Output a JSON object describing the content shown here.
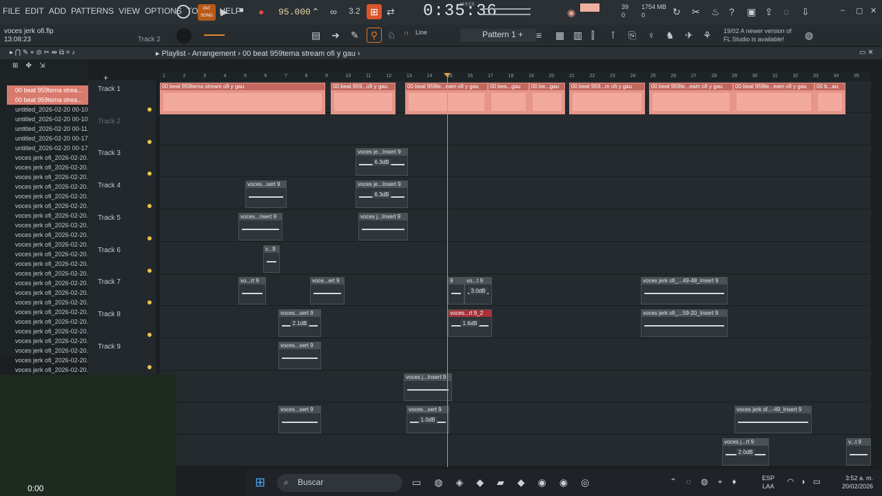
{
  "menu": [
    "FILE",
    "EDIT",
    "ADD",
    "PATTERNS",
    "VIEW",
    "OPTIONS",
    "TOOLS",
    "HELP"
  ],
  "transport": {
    "mode_pat": "PAT",
    "mode_song": "SONG",
    "tempo": "95.000",
    "clock": "0:35:36",
    "clock_unit": "M:S:CS",
    "cpu": "39",
    "cpu2": "0",
    "memory": "1754 MB",
    "memory2": "0"
  },
  "file": {
    "name": "voces jerk ofi.flp",
    "time": "13:08:23",
    "hint": "Track 2"
  },
  "toolbar": {
    "line_label": "Line",
    "pattern_label": "Pattern 1"
  },
  "notice": {
    "date": "19/02",
    "line1": "A newer version of",
    "line2": "FL Studio is available!"
  },
  "playlist": {
    "title": "Playlist - Arrangement",
    "breadcrumb": "00 beat 959tema stream ofi y gau"
  },
  "browser": {
    "items": [
      "00 beat 959tema strea...",
      "00 beat 959tema strea...",
      "untitled_2026-02-20 00-10...",
      "untitled_2026-02-20 00-10...",
      "untitled_2026-02-20 00-11...",
      "untitled_2026-02-20 00-17...",
      "untitled_2026-02-20 00-17...",
      "voces jerk ofi_2026-02-20...",
      "voces jerk ofi_2026-02-20...",
      "voces jerk ofi_2026-02-20...",
      "voces jerk ofi_2026-02-20...",
      "voces jerk ofi_2026-02-20...",
      "voces jerk ofi_2026-02-20...",
      "voces jerk ofi_2026-02-20...",
      "voces jerk ofi_2026-02-20...",
      "voces jerk ofi_2026-02-20...",
      "voces jerk ofi_2026-02-20...",
      "voces jerk ofi_2026-02-20...",
      "voces jerk ofi_2026-02-20...",
      "voces jerk ofi_2026-02-20...",
      "voces jerk ofi_2026-02-20...",
      "voces jerk ofi_2026-02-20...",
      "voces jerk ofi_2026-02-20...",
      "voces jerk ofi_2026-02-20...",
      "voces jerk ofi_2026-02-20...",
      "voces jerk ofi_2026-02-20...",
      "voces jerk ofi_2026-02-20...",
      "voces jerk ofi_2026-02-20...",
      "voces jerk ofi_2026-02-20...",
      "voces jerk ofi_2026-02-20..."
    ]
  },
  "tracks": [
    "Track 1",
    "Track 2",
    "Track 3",
    "Track 4",
    "Track 5",
    "Track 6",
    "Track 7",
    "Track 8",
    "Track 9"
  ],
  "ruler": [
    "1",
    "2",
    "3",
    "4",
    "5",
    "6",
    "7",
    "8",
    "9",
    "10",
    "11",
    "12",
    "13",
    "14",
    "15",
    "16",
    "17",
    "18",
    "19",
    "20",
    "21",
    "22",
    "23",
    "24",
    "25",
    "26",
    "27",
    "28",
    "29",
    "30",
    "31",
    "32",
    "33",
    "34",
    "35"
  ],
  "clips": {
    "t1a": "00 beat 959tema stream ofi y gau",
    "t1b": "00 beat 959...ofi y gau",
    "t1c": "00 beat 959te...eam ofi y gau",
    "t1d": "00 bea...gau",
    "t1e": "00 be...gau",
    "t1f": "00 beat 959...m ofi y gau",
    "t1g": "00 beat 959te...eam ofi y gau",
    "t1h": "00 beat 959te...eam ofi y gau",
    "t1i": "00 b...au",
    "t3a": "voces je...Insert 9",
    "t3a_db": "6.3dB",
    "t4a": "voces...sert 9",
    "t4b": "voces je...Insert 9",
    "t4b_db": "6.3dB",
    "t5a": "voces...nsert 9",
    "t5b": "voces j...Insert 9",
    "t6a": "v...9",
    "t7a": "vo...rt 9",
    "t7b": "voce...ert 9",
    "t7c": "9",
    "t7d": "vo...t 9",
    "t7d_db": "3.0dB",
    "t7e": "voces jerk ofi_...49-48_Insert 9",
    "t8a": "voces...sert 9",
    "t8a_db": "2.1dB",
    "t8b": "voces...rt 9_2",
    "t8b_db": "1.6dB",
    "t8c": "voces jerk ofi_...59-20_Insert 9",
    "t9a": "voces...sert 9",
    "x1": "voces j...Insert 9",
    "x2": "voces...sert 9",
    "x3": "voces...sert 9",
    "x3_db": "1.0dB",
    "x4": "voces jerk of...-49_Insert 9",
    "x5": "voces j...rt 9",
    "x5_db": "2.0dB",
    "x6": "v...t 9"
  },
  "webcam": {
    "time": "0:00"
  },
  "taskbar": {
    "search": "Buscar",
    "lang": "ESP",
    "lang2": "LAA",
    "time": "3:52 a. m.",
    "date": "20/02/2026"
  }
}
